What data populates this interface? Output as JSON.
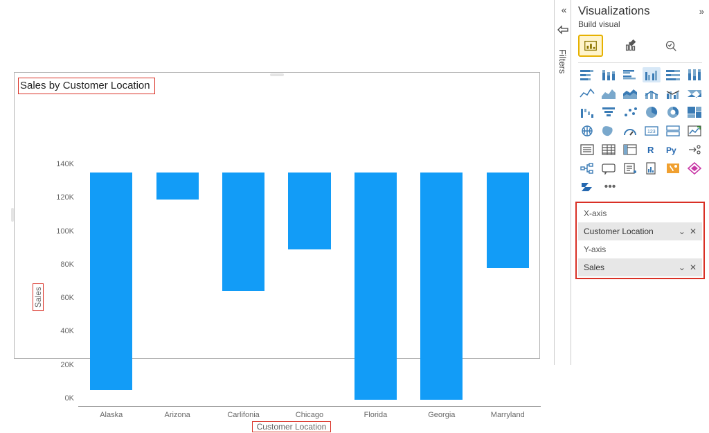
{
  "chart_data": {
    "type": "bar",
    "title": "Sales by Customer Location",
    "xlabel": "Customer Location",
    "ylabel": "Sales",
    "ylim": [
      0,
      140000
    ],
    "y_ticks": [
      "0K",
      "20K",
      "40K",
      "60K",
      "80K",
      "100K",
      "120K",
      "140K"
    ],
    "categories": [
      "Alaska",
      "Arizona",
      "Carlifonia",
      "Chicago",
      "Florida",
      "Georgia",
      "Marryland"
    ],
    "values": [
      130000,
      16000,
      71000,
      46000,
      136000,
      136000,
      57000
    ]
  },
  "panel": {
    "title": "Visualizations",
    "subtitle": "Build visual",
    "filters_label": "Filters",
    "xaxis_label": "X-axis",
    "xaxis_field": "Customer Location",
    "yaxis_label": "Y-axis",
    "yaxis_field": "Sales"
  }
}
